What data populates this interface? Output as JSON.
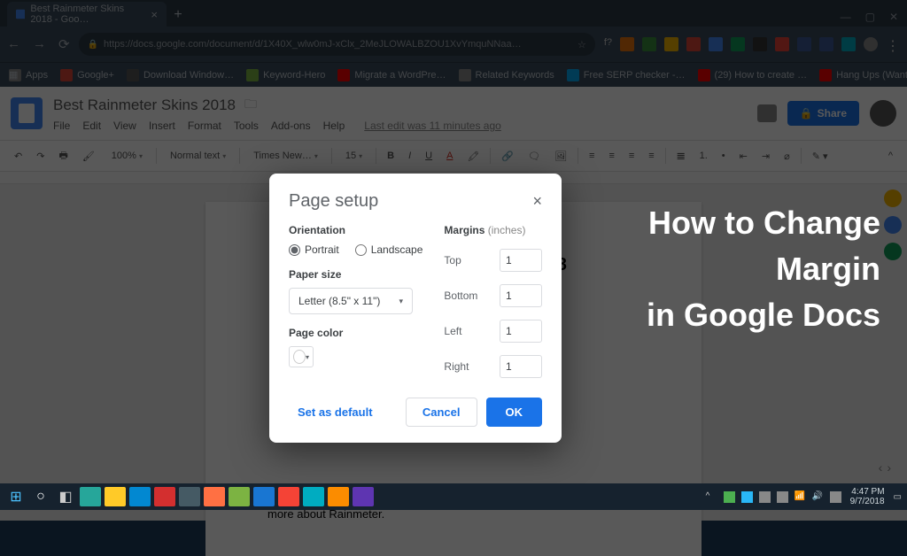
{
  "browser": {
    "tab_title": "Best Rainmeter Skins 2018 - Goo…",
    "url": "https://docs.google.com/document/d/1X40X_wlw0mJ-xClx_2MeJLOWALBZOU1XvYmquNNaa…",
    "window_controls": {
      "min": "—",
      "max": "▢",
      "close": "✕"
    }
  },
  "bookmarks": [
    {
      "label": "Apps"
    },
    {
      "label": "Google+"
    },
    {
      "label": "Download Window…"
    },
    {
      "label": "Keyword-Hero"
    },
    {
      "label": "Migrate a WordPre…"
    },
    {
      "label": "Related Keywords"
    },
    {
      "label": "Free SERP checker -…"
    },
    {
      "label": "(29) How to create …"
    },
    {
      "label": "Hang Ups (Want Yo…"
    }
  ],
  "docs": {
    "title": "Best Rainmeter Skins 2018",
    "menus": [
      "File",
      "Edit",
      "View",
      "Insert",
      "Format",
      "Tools",
      "Add-ons",
      "Help"
    ],
    "last_edit": "Last edit was 11 minutes ago",
    "share": "Share",
    "toolbar": {
      "zoom": "100%",
      "styles": "Normal text",
      "font": "Times New…",
      "size": "15"
    }
  },
  "page_content": {
    "heading": "Best Rainmeter Skins 2018",
    "para": "might be lots of question originating in your mind right? Let's explore more about Rainmeter."
  },
  "dialog": {
    "title": "Page setup",
    "orientation_label": "Orientation",
    "portrait": "Portrait",
    "landscape": "Landscape",
    "paper_size_label": "Paper size",
    "paper_size_value": "Letter (8.5\" x 11\")",
    "page_color_label": "Page color",
    "margins_label": "Margins",
    "margins_unit": "(inches)",
    "margins": {
      "top_label": "Top",
      "top": "1",
      "bottom_label": "Bottom",
      "bottom": "1",
      "left_label": "Left",
      "left": "1",
      "right_label": "Right",
      "right": "1"
    },
    "set_default": "Set as default",
    "cancel": "Cancel",
    "ok": "OK"
  },
  "overlay": {
    "line1": "How to Change",
    "line2": "Margin",
    "line3": "in Google Docs"
  },
  "taskbar": {
    "time": "4:47 PM",
    "date": "9/7/2018"
  }
}
